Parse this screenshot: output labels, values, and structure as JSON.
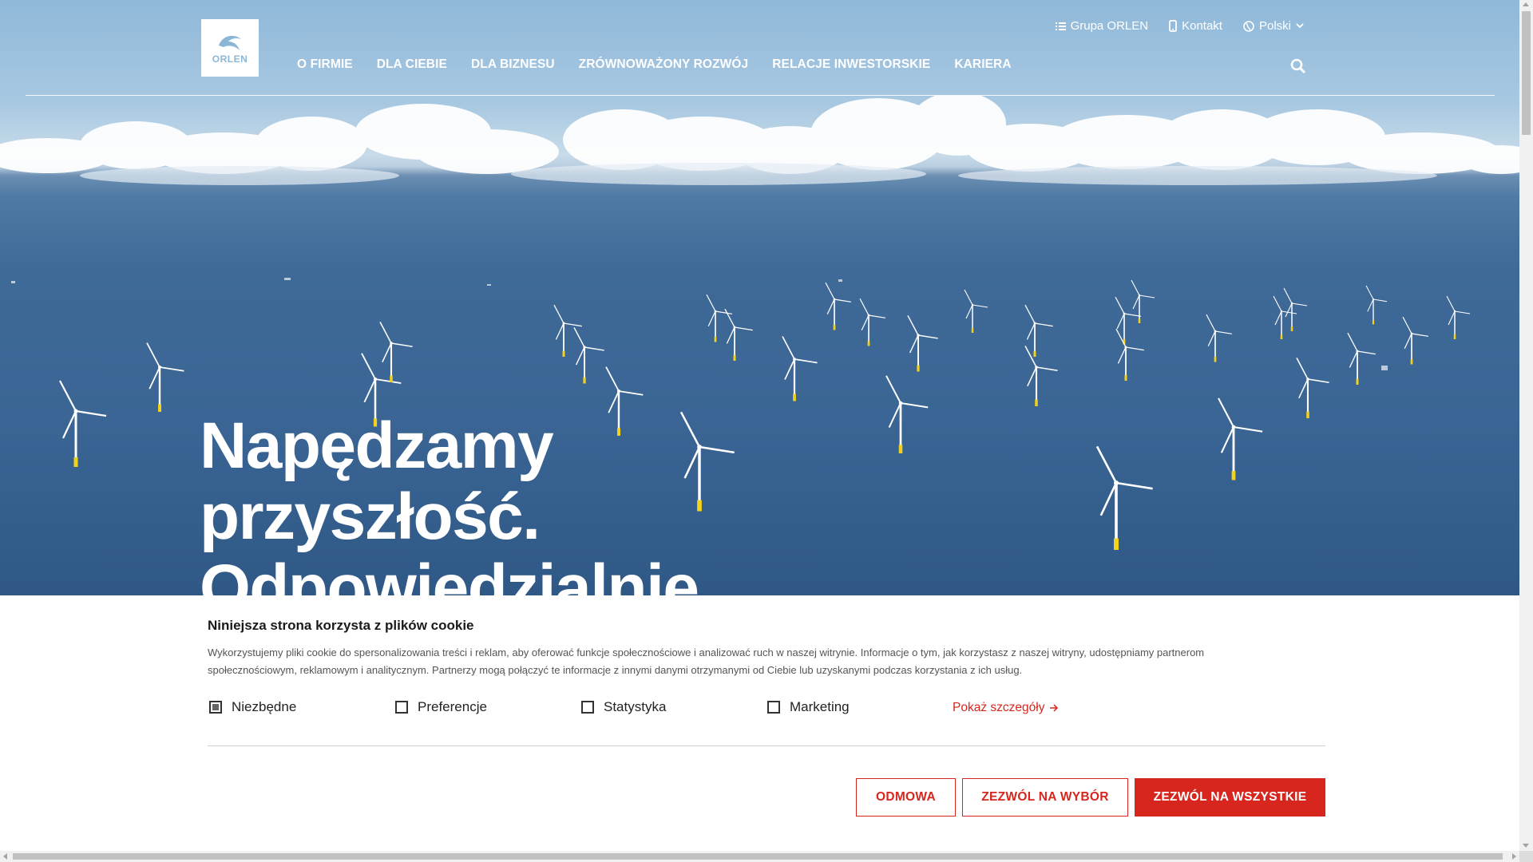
{
  "brand": {
    "logo_text": "ORLEN"
  },
  "topbar": {
    "group_label": "Grupa ORLEN",
    "contact_label": "Kontakt",
    "language_label": "Polski"
  },
  "nav": {
    "items": [
      "O FIRMIE",
      "DLA CIEBIE",
      "DLA BIZNESU",
      "ZRÓWNOWAŻONY ROZWÓJ",
      "RELACJE INWESTORSKIE",
      "KARIERA"
    ]
  },
  "hero": {
    "headline_lines": [
      "Napędzamy",
      "przyszłość.",
      "Odpowiedzialnie."
    ]
  },
  "cookie": {
    "title": "Niniejsza strona korzysta z plików cookie",
    "text": "Wykorzystujemy pliki cookie do spersonalizowania treści i reklam, aby oferować funkcje społecznościowe i analizować ruch w naszej witrynie. Informacje o tym, jak korzystasz z naszej witryny, udostępniamy partnerom społecznościowym, reklamowym i analitycznym. Partnerzy mogą połączyć te informacje z innymi danymi otrzymanymi od Ciebie lub uzyskanymi podczas korzystania z ich usług.",
    "checkboxes": [
      {
        "label": "Niezbędne",
        "checked": true
      },
      {
        "label": "Preferencje",
        "checked": false
      },
      {
        "label": "Statystyka",
        "checked": false
      },
      {
        "label": "Marketing",
        "checked": false
      }
    ],
    "details_label": "Pokaż szczegóły",
    "buttons": {
      "deny": "ODMOWA",
      "allow_selection": "ZEZWÓL NA WYBÓR",
      "allow_all": "ZEZWÓL NA WSZYSTKIE"
    }
  },
  "colors": {
    "accent": "#d7261e",
    "sea": "#3a6594",
    "sky": "#9fc2df"
  }
}
